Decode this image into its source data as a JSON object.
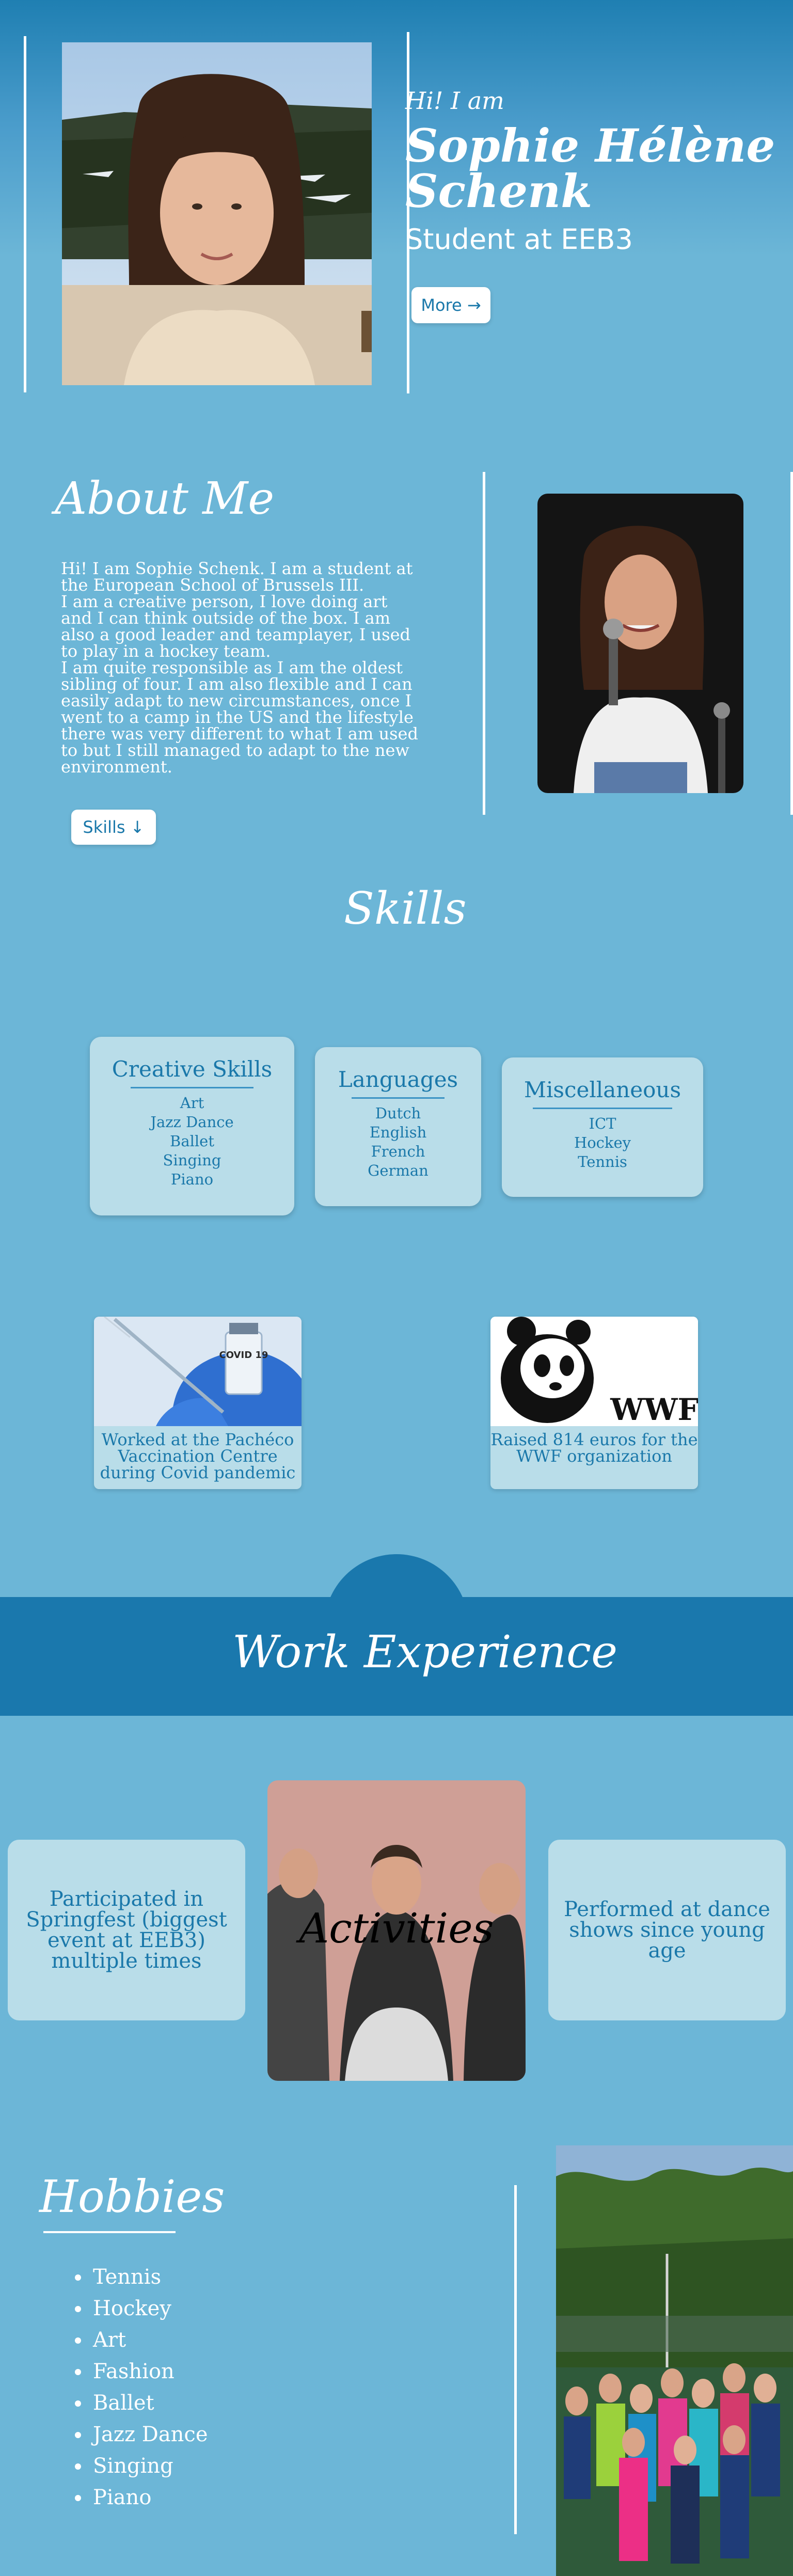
{
  "hero": {
    "greeting": "Hi! I am",
    "name": "Sophie Hélène Schenk",
    "role": "Student at EEB3",
    "more_button": "More →"
  },
  "about": {
    "title": "About Me",
    "paragraphs": [
      "Hi! I am Sophie Schenk. I am a student at the European School of Brussels III.",
      "I am a creative person, I love doing art and I can think outside of the box. I am also a good leader and teamplayer, I used to play in a hockey team.",
      "I am quite responsible as I am the oldest sibling of four. I am also flexible and I can easily adapt to new circumstances, once I went to a camp in the US and the lifestyle there was very different to what I am used to but I still managed to adapt to the new environment."
    ],
    "skills_button": "Skills ↓"
  },
  "skills": {
    "title": "Skills",
    "cards": [
      {
        "title": "Creative Skills",
        "items": [
          "Art",
          "Jazz Dance",
          "Ballet",
          "Singing",
          "Piano"
        ]
      },
      {
        "title": "Languages",
        "items": [
          "Dutch",
          "English",
          "French",
          "German"
        ]
      },
      {
        "title": "Miscellaneous",
        "items": [
          "ICT",
          "Hockey",
          "Tennis"
        ]
      }
    ]
  },
  "achievements": [
    {
      "caption": "Worked at the Pachéco Vaccination Centre during Covid pandemic",
      "icon": "covid-vaccine-image",
      "vial_text": "COVID 19"
    },
    {
      "caption": "Raised 814 euros for the WWF organization",
      "icon": "wwf-panda-logo",
      "logo_text": "WWF"
    }
  ],
  "work": {
    "title": "Work Experience",
    "left_card": "Participated in Springfest (biggest event at EEB3) multiple times",
    "center_label": "Activities",
    "right_card": "Performed at dance shows since young age"
  },
  "hobbies": {
    "title": "Hobbies",
    "items": [
      "Tennis",
      "Hockey",
      "Art",
      "Fashion",
      "Ballet",
      "Jazz Dance",
      "Singing",
      "Piano"
    ]
  },
  "colors": {
    "background": "#6cb6d7",
    "accent": "#1a78ad",
    "card": "#b9dde9",
    "card_text": "#1a78aa"
  }
}
